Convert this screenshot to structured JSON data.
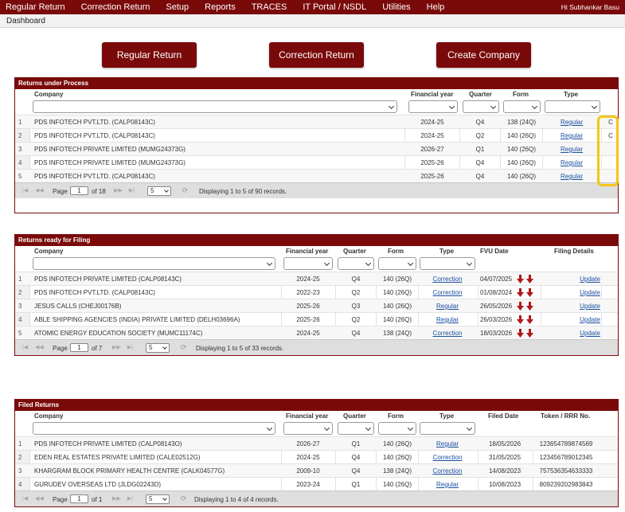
{
  "nav": {
    "items": [
      "Regular Return",
      "Correction Return",
      "Setup",
      "Reports",
      "TRACES",
      "IT Portal / NSDL",
      "Utilities",
      "Help"
    ],
    "user_greeting": "Hi Subhankar Basu"
  },
  "breadcrumb": "Dashboard",
  "actions": {
    "regular_return": "Regular Return",
    "correction_return": "Correction Return",
    "create_company": "Create Company"
  },
  "under_process": {
    "title": "Returns under Process",
    "columns": {
      "company": "Company",
      "fy": "Financial year",
      "quarter": "Quarter",
      "form": "Form",
      "type": "Type"
    },
    "rows": [
      {
        "num": "1",
        "company": "PDS INFOTECH PVT.LTD. (CALP08143C)",
        "fy": "2024-25",
        "quarter": "Q4",
        "form": "138 (24Q)",
        "type": "Regular",
        "extra": "C"
      },
      {
        "num": "2",
        "company": "PDS INFOTECH PVT.LTD. (CALP08143C)",
        "fy": "2024-25",
        "quarter": "Q2",
        "form": "140 (26Q)",
        "type": "Regular",
        "extra": "C"
      },
      {
        "num": "3",
        "company": "PDS INFOTECH PRIVATE LIMITED (MUMG24373G)",
        "fy": "2026-27",
        "quarter": "Q1",
        "form": "140 (26Q)",
        "type": "Regular",
        "extra": ""
      },
      {
        "num": "4",
        "company": "PDS INFOTECH PRIVATE LIMITED (MUMG24373G)",
        "fy": "2025-26",
        "quarter": "Q4",
        "form": "140 (26Q)",
        "type": "Regular",
        "extra": ""
      },
      {
        "num": "5",
        "company": "PDS INFOTECH PVT.LTD. (CALP08143C)",
        "fy": "2025-26",
        "quarter": "Q4",
        "form": "140 (26Q)",
        "type": "Regular",
        "extra": ""
      }
    ],
    "pager": {
      "page_label": "Page",
      "page": "1",
      "of": "of 18",
      "page_size": "5",
      "summary": "Displaying 1 to 5 of 90 records."
    }
  },
  "ready_for_filing": {
    "title": "Returns ready for Filing",
    "columns": {
      "company": "Company",
      "fy": "Financial year",
      "quarter": "Quarter",
      "form": "Form",
      "type": "Type",
      "fvu": "FVU Date",
      "filing": "Filing Details"
    },
    "rows": [
      {
        "num": "1",
        "company": "PDS INFOTECH PRIVATE LIMITED (CALP08143C)",
        "fy": "2024-25",
        "quarter": "Q4",
        "form": "140 (26Q)",
        "type": "Correction",
        "fvu": "04/07/2025",
        "filing": "Update"
      },
      {
        "num": "2",
        "company": "PDS INFOTECH PVT.LTD. (CALP08143C)",
        "fy": "2022-23",
        "quarter": "Q2",
        "form": "140 (26Q)",
        "type": "Correction",
        "fvu": "01/08/2024",
        "filing": "Update"
      },
      {
        "num": "3",
        "company": "JESUS CALLS (CHEJ00176B)",
        "fy": "2025-26",
        "quarter": "Q3",
        "form": "140 (26Q)",
        "type": "Regular",
        "fvu": "26/05/2026",
        "filing": "Update"
      },
      {
        "num": "4",
        "company": "ABLE SHIPPING AGENCIES (INDIA) PRIVATE LIMITED (DELH03696A)",
        "fy": "2025-26",
        "quarter": "Q2",
        "form": "140 (26Q)",
        "type": "Regular",
        "fvu": "26/03/2026",
        "filing": "Update"
      },
      {
        "num": "5",
        "company": "ATOMIC ENERGY EDUCATION SOCIETY (MUMC11174C)",
        "fy": "2024-25",
        "quarter": "Q4",
        "form": "138 (24Q)",
        "type": "Correction",
        "fvu": "18/03/2026",
        "filing": "Update"
      }
    ],
    "pager": {
      "page_label": "Page",
      "page": "1",
      "of": "of 7",
      "page_size": "5",
      "summary": "Displaying 1 to 5 of 33 records."
    }
  },
  "filed": {
    "title": "Filed Returns",
    "columns": {
      "company": "Company",
      "fy": "Financial year",
      "quarter": "Quarter",
      "form": "Form",
      "type": "Type",
      "filed": "Filed Date",
      "token": "Token / RRR No."
    },
    "rows": [
      {
        "num": "1",
        "company": "PDS INFOTECH PRIVATE LIMITED (CALP08143O)",
        "fy": "2026-27",
        "quarter": "Q1",
        "form": "140 (26Q)",
        "type": "Regular",
        "filed": "18/05/2026",
        "token": "123654789874569"
      },
      {
        "num": "2",
        "company": "EDEN REAL ESTATES PRIVATE LIMITED (CALE02512G)",
        "fy": "2024-25",
        "quarter": "Q4",
        "form": "140 (26Q)",
        "type": "Correction",
        "filed": "31/05/2025",
        "token": "123456789012345"
      },
      {
        "num": "3",
        "company": "KHARGRAM BLOCK PRIMARY HEALTH CENTRE (CALK04577G)",
        "fy": "2009-10",
        "quarter": "Q4",
        "form": "138 (24Q)",
        "type": "Correction",
        "filed": "14/08/2023",
        "token": "757536354633333"
      },
      {
        "num": "4",
        "company": "GURUDEV OVERSEAS LTD (JLDG02243D)",
        "fy": "2023-24",
        "quarter": "Q1",
        "form": "140 (26Q)",
        "type": "Regular",
        "filed": "10/08/2023",
        "token": "809239202983843"
      }
    ],
    "pager": {
      "page_label": "Page",
      "page": "1",
      "of": "of 1",
      "page_size": "5",
      "summary": "Displaying 1 to 4 of 4 records."
    }
  },
  "colors": {
    "brand": "#7a0a0a",
    "link": "#1a4fa0",
    "highlight": "#f5c518",
    "arrow": "#b01818"
  }
}
